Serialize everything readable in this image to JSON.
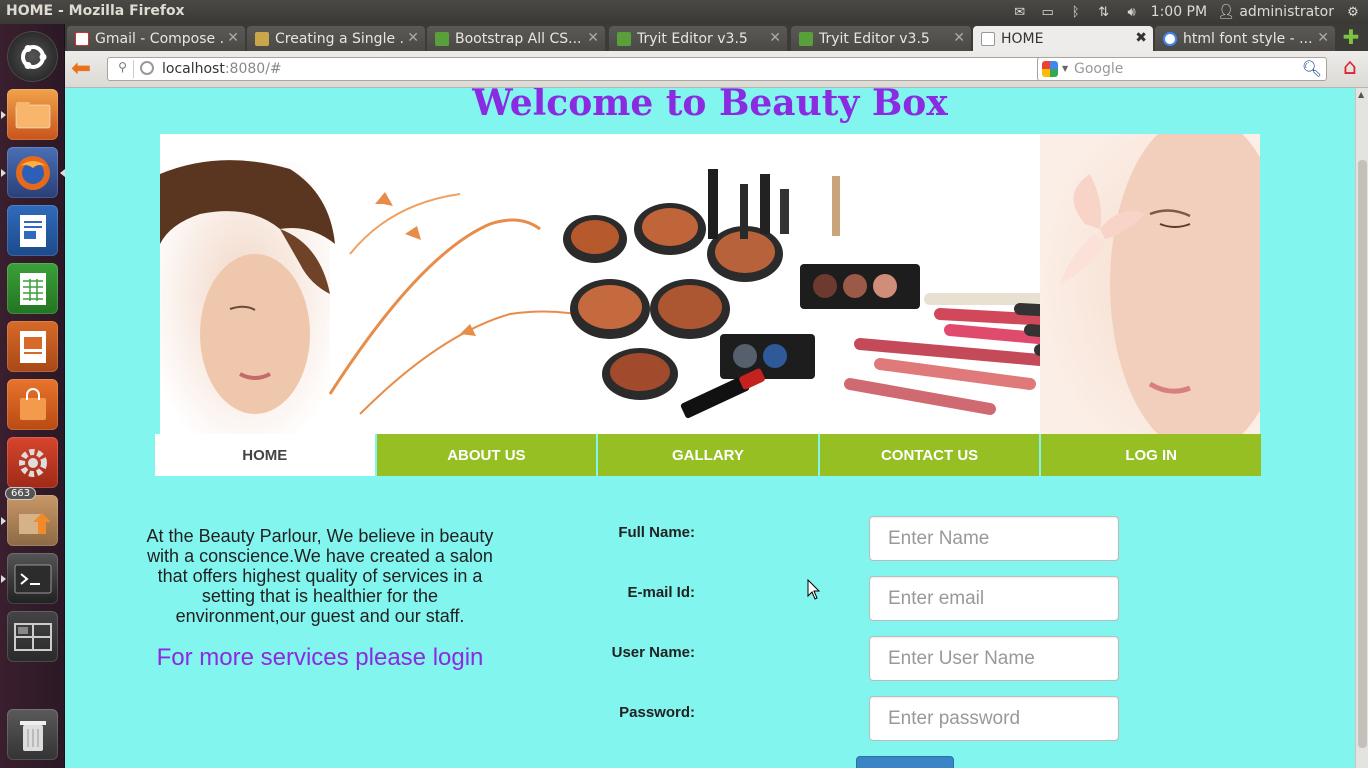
{
  "window": {
    "title": "HOME - Mozilla Firefox",
    "tray": {
      "time": "1:00 PM",
      "user": "administrator"
    }
  },
  "launcher": {
    "badge_count": "663"
  },
  "tabs": [
    {
      "label": "Gmail - Compose ...",
      "active": false
    },
    {
      "label": "Creating a Single ...",
      "active": false
    },
    {
      "label": "Bootstrap All CS...",
      "active": false
    },
    {
      "label": "Tryit Editor v3.5",
      "active": false
    },
    {
      "label": "Tryit Editor v3.5",
      "active": false
    },
    {
      "label": "HOME",
      "active": true
    },
    {
      "label": "html font style - ...",
      "active": false
    }
  ],
  "navbar": {
    "url_host": "localhost",
    "url_rest": ":8080/#",
    "search_placeholder": "Google"
  },
  "page": {
    "title": "Welcome to Beauty Box",
    "menu": [
      "HOME",
      "ABOUT US",
      "GALLARY",
      "CONTACT US",
      "LOG IN"
    ],
    "intro": "At the Beauty Parlour, We believe in beauty with a conscience.We have created a salon that offers highest quality of services in a setting that is healthier for the environment,our guest and our staff.",
    "login_cta": "For more services please login",
    "form": {
      "full_name_label": "Full Name:",
      "full_name_placeholder": "Enter Name",
      "email_label": "E-mail Id:",
      "email_placeholder": "Enter email",
      "username_label": "User Name:",
      "username_placeholder": "Enter User Name",
      "password_label": "Password:",
      "password_placeholder": "Enter password"
    }
  },
  "colors": {
    "page_bg": "#83f5ef",
    "title": "#8a2be2",
    "menu_bg": "#96bf24",
    "cta": "#8a2be2"
  }
}
